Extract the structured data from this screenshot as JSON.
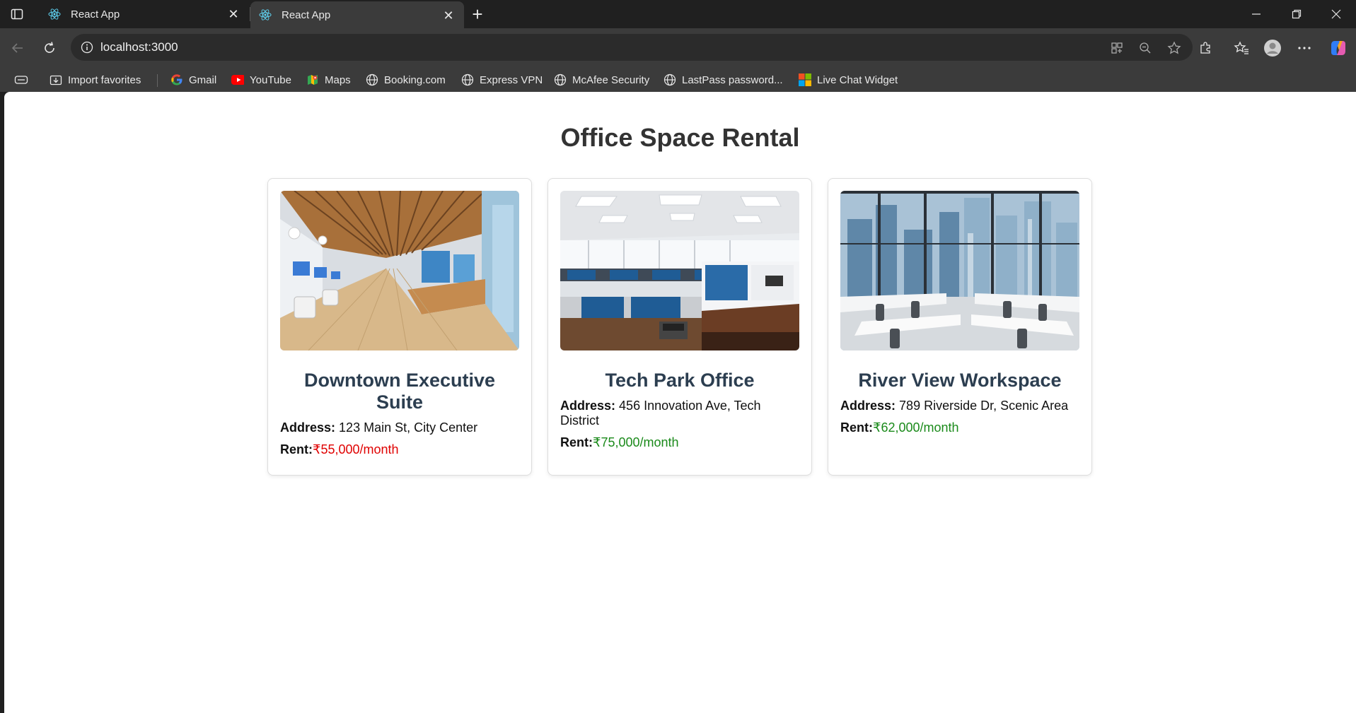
{
  "browser": {
    "tabs": [
      {
        "title": "React App"
      },
      {
        "title": "React App"
      }
    ],
    "url": "localhost:3000",
    "favorites": [
      {
        "label": "Import favorites",
        "icon": "import-icon"
      },
      {
        "label": "Gmail",
        "icon": "google-icon"
      },
      {
        "label": "YouTube",
        "icon": "youtube-icon"
      },
      {
        "label": "Maps",
        "icon": "maps-icon"
      },
      {
        "label": "Booking.com",
        "icon": "globe-icon"
      },
      {
        "label": "Express VPN",
        "icon": "globe-icon"
      },
      {
        "label": "McAfee Security",
        "icon": "globe-icon"
      },
      {
        "label": "LastPass password...",
        "icon": "globe-icon"
      },
      {
        "label": "Live Chat Widget",
        "icon": "microsoft-icon"
      }
    ]
  },
  "page": {
    "title": "Office Space Rental",
    "address_label": "Address:",
    "rent_label": "Rent:",
    "offices": [
      {
        "name": "Downtown Executive Suite",
        "address": "123 Main St, City Center",
        "rent": "₹55,000/month",
        "rent_color": "#e00000"
      },
      {
        "name": "Tech Park Office",
        "address": "456 Innovation Ave, Tech District",
        "rent": "₹75,000/month",
        "rent_color": "#1a8a1a"
      },
      {
        "name": "River View Workspace",
        "address": "789 Riverside Dr, Scenic Area",
        "rent": "₹62,000/month",
        "rent_color": "#1a8a1a"
      }
    ]
  }
}
